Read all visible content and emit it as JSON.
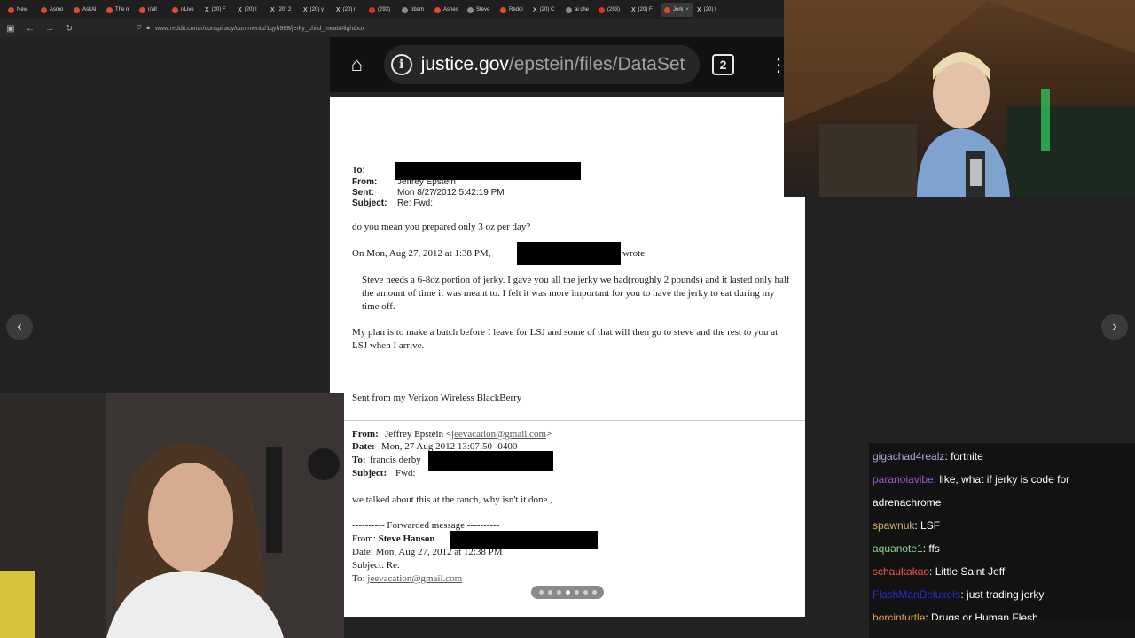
{
  "browser": {
    "tabs": [
      {
        "title": "New",
        "icon": "reddit-icon"
      },
      {
        "title": "Asmo",
        "icon": "reddit-icon"
      },
      {
        "title": "AskAl",
        "icon": "reddit-icon"
      },
      {
        "title": "The n",
        "icon": "reddit-icon"
      },
      {
        "title": "r/all",
        "icon": "reddit-icon"
      },
      {
        "title": "r/Live",
        "icon": "reddit-icon"
      },
      {
        "title": "(20) F",
        "icon": "x-icon"
      },
      {
        "title": "(20) I",
        "icon": "x-icon"
      },
      {
        "title": "(20) 2",
        "icon": "x-icon"
      },
      {
        "title": "(20) y",
        "icon": "x-icon"
      },
      {
        "title": "(20) n",
        "icon": "x-icon"
      },
      {
        "title": "(293)",
        "icon": "youtube-icon"
      },
      {
        "title": "obam",
        "icon": "globe-icon"
      },
      {
        "title": "Ashes",
        "icon": "reddit-icon"
      },
      {
        "title": "Steve",
        "icon": "globe-icon"
      },
      {
        "title": "Reddi",
        "icon": "reddit-icon"
      },
      {
        "title": "(20) C",
        "icon": "x-icon"
      },
      {
        "title": "ai che",
        "icon": "globe-icon"
      },
      {
        "title": "(293)",
        "icon": "youtube-icon"
      },
      {
        "title": "(20) F",
        "icon": "x-icon"
      },
      {
        "title": "Jerk",
        "icon": "reddit-icon",
        "active": true
      },
      {
        "title": "(20) I",
        "icon": "x-icon"
      }
    ],
    "url": "www.reddit.com/r/conspiracy/comments/1qyh988/jerky_child_meat/#lightbox"
  },
  "phone": {
    "domain": "justice.gov",
    "path": "/epstein/files/DataSet",
    "tab_count": "2"
  },
  "email1": {
    "to_label": "To:",
    "from_label": "From:",
    "from_value": "Jeffrey Epstein",
    "sent_label": "Sent:",
    "sent_value": "Mon 8/27/2012 5:42:19 PM",
    "subject_label": "Subject:",
    "subject_value": "Re: Fwd:",
    "body1": "do you mean you prepared  only 3 oz  per day?",
    "quote_intro": "On Mon, Aug 27, 2012 at 1:38 PM,",
    "quote_wrote": "wrote:",
    "quote_p1": "Steve needs a 6-8oz portion of jerky. I gave you all the jerky we had(roughly 2 pounds) and it lasted only half the amount of time it was meant to. I felt it was more important for you to have the jerky to eat during my time off.",
    "quote_p2": "My plan is to make a batch before I leave for LSJ and some of that will then go to steve and the rest to you at LSJ when I arrive.",
    "signature": "Sent from my Verizon Wireless BlackBerry"
  },
  "email2": {
    "from_label": "From:",
    "from_name": "Jeffrey Epstein <",
    "from_email": "jeevacation@gmail.com",
    "from_close": ">",
    "date_label": "Date:",
    "date_value": "Mon, 27 Aug 2012 13:07:50 -0400",
    "to_label": "To:",
    "to_value": "francis derby",
    "subject_label": "Subject:",
    "subject_value": "Fwd:",
    "body": "we talked about this at the ranch, why isn't it done ,",
    "fwd_header": "---------- Forwarded message ----------",
    "fwd_from_label": "From:",
    "fwd_from_value": "Steve Hanson",
    "fwd_date": "Date: Mon, Aug 27, 2012 at 12:38 PM",
    "fwd_subject": "Subject: Re:",
    "fwd_to_label": "To:",
    "fwd_to_value": "jeevacation@gmail.com"
  },
  "chat": [
    {
      "user": "gigachad4realz",
      "color": "#b9a3e3",
      "text": "fortnite"
    },
    {
      "user": "paranoiavibe",
      "color": "#9b59d0",
      "text": "like, what if jerky is code for"
    },
    {
      "user": "",
      "color": "#ffffff",
      "text": "adrenachrome"
    },
    {
      "user": "spawnuk",
      "color": "#d4b06a",
      "text": "LSF"
    },
    {
      "user": "aquanote1",
      "color": "#8fd18f",
      "text": "ffs"
    },
    {
      "user": "schaukakao",
      "color": "#ff5050",
      "text": "Little Saint Jeff"
    },
    {
      "user": "FlashManDeluxeIs",
      "color": "#2b2bd6",
      "text": "just trading jerky"
    },
    {
      "user": "borcinturtle",
      "color": "#e0a040",
      "text": "Drugs or Human Flesh"
    }
  ]
}
